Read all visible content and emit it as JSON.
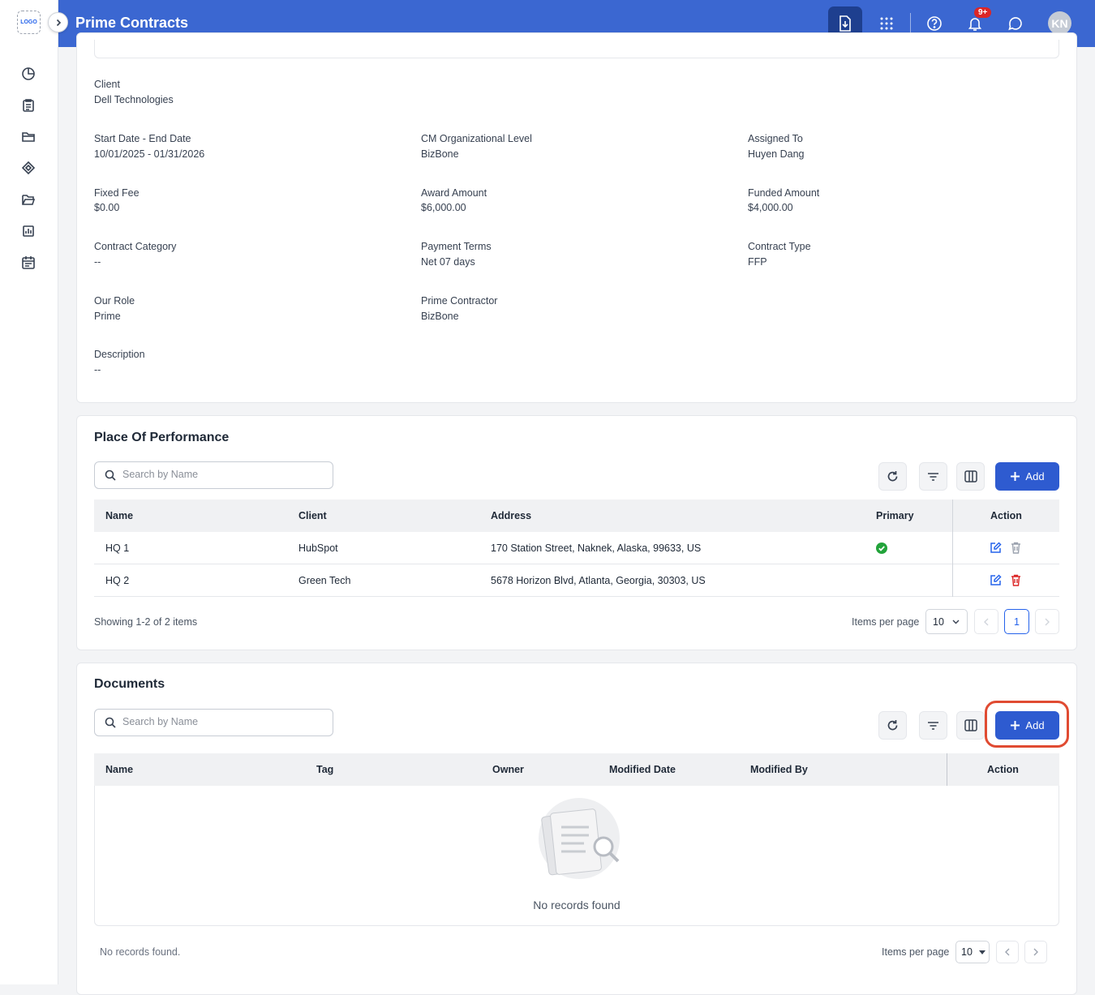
{
  "app": {
    "title": "Prime Contracts",
    "logo_text": "LOGO",
    "notification_count": "9+",
    "user_initials": "KN"
  },
  "sidebar": {
    "icons": [
      "dashboard-icon",
      "clipboard-icon",
      "folder-icon",
      "tag-icon",
      "folder-open-icon",
      "report-icon",
      "calendar-icon"
    ]
  },
  "details": {
    "client_label": "Client",
    "client_value": "Dell Technologies",
    "dates_label": "Start Date - End Date",
    "dates_value": "10/01/2025 - 01/31/2026",
    "org_label": "CM Organizational Level",
    "org_value": "BizBone",
    "assigned_label": "Assigned To",
    "assigned_value": "Huyen Dang",
    "fee_label": "Fixed Fee",
    "fee_value": "$0.00",
    "award_label": "Award Amount",
    "award_value": "$6,000.00",
    "funded_label": "Funded Amount",
    "funded_value": "$4,000.00",
    "category_label": "Contract Category",
    "category_value": "--",
    "terms_label": "Payment Terms",
    "terms_value": "Net 07 days",
    "type_label": "Contract Type",
    "type_value": "FFP",
    "role_label": "Our Role",
    "role_value": "Prime",
    "prime_label": "Prime Contractor",
    "prime_value": "BizBone",
    "desc_label": "Description",
    "desc_value": "--"
  },
  "performance": {
    "title": "Place Of Performance",
    "search_placeholder": "Search by Name",
    "add_label": "Add",
    "columns": {
      "name": "Name",
      "client": "Client",
      "address": "Address",
      "primary": "Primary",
      "action": "Action"
    },
    "rows": [
      {
        "name": "HQ 1",
        "client": "HubSpot",
        "address": "170 Station Street, Naknek, Alaska, 99633, US",
        "primary": true
      },
      {
        "name": "HQ 2",
        "client": "Green Tech",
        "address": "5678 Horizon Blvd, Atlanta, Georgia, 30303, US",
        "primary": false
      }
    ],
    "showing": "Showing 1-2 of 2 items",
    "items_per_page_label": "Items per page",
    "items_per_page": "10",
    "current_page": "1"
  },
  "documents": {
    "title": "Documents",
    "search_placeholder": "Search by Name",
    "add_label": "Add",
    "columns": {
      "name": "Name",
      "tag": "Tag",
      "owner": "Owner",
      "modified_date": "Modified Date",
      "modified_by": "Modified By",
      "action": "Action"
    },
    "empty_text": "No records found",
    "footer_text": "No records found.",
    "items_per_page_label": "Items per page",
    "items_per_page": "10"
  },
  "colors": {
    "topbar": "#3b67d1",
    "primary_button": "#2e5bd0",
    "highlight": "#e04b32",
    "delete_red": "#dc2626",
    "check_green": "#22a33a"
  }
}
